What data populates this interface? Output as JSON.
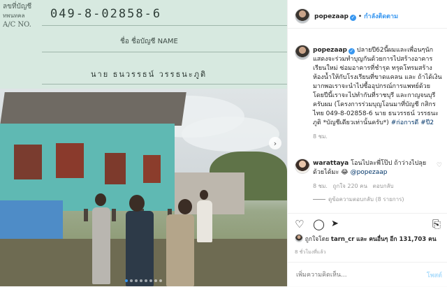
{
  "passbook": {
    "acct_label_th": "ลขที่บัญชี",
    "acct_label_th2": "บัญชี",
    "acct_label_th3": "ทพนทคล",
    "acct_label_en": "A/C NO.",
    "account_number": "049-8-02858-6",
    "name_label": "ชื่อ ชื่อบัญชี NAME",
    "owner_name": "นาย ธนวรรธน์ วรรธนะภูติ"
  },
  "carousel": {
    "next_icon": "chevron-right-icon",
    "count": 8,
    "active": 0
  },
  "header": {
    "username": "popezaap",
    "separator": "•",
    "follow_label": "กำลังติดตาม"
  },
  "caption": {
    "username": "popezaap",
    "text": "ปลายปี62นี้ผมและเพื่อนๆนักแสดงจะร่วมทำบุญกันด้วยการไปสร้างอาคารเรียนใหม่ ซ่อมอาคารที่ชำรุด ทรุดโทรมสร้างห้องน้ำให้กับโรงเรียนที่ขาดแคลน และ ถ้าได้เงินมากพอเราจะนำไปซื้ออุปกรณ์การแพทย์ด้วย โดยปีนี้เราจะไปทำกันที่ราชบุรี และกาญจนบุรี ครับผม (โครงการร่วมบุญโอนมาที่บัญชี กสิกรไทย 049-8-02858-6 นาย ธนวรรธน์ วรรธนะภูติ *บัญชีเดียวเท่านั้นครับ*)",
    "hashtag1": "#ก่อการดี",
    "hashtag2": "#ปี2",
    "time": "8 ชม."
  },
  "comment": {
    "username": "warattaya",
    "text": "โอนไปละพี่โป๊ป ถ้าว่างไปลุยด้วยได้มะ 😂",
    "mention": "@popezaap",
    "time": "8 ชม.",
    "likes": "ถูกใจ 220 คน",
    "reply": "ตอบกลับ",
    "view_replies": "ดูข้อความตอบกลับ (8 รายการ)"
  },
  "actions": {
    "like_icon": "heart-icon",
    "comment_icon": "comment-icon",
    "share_icon": "share-icon",
    "save_icon": "bookmark-icon"
  },
  "likes": {
    "prefix": "ถูกใจโดย",
    "user": "tarn_cr",
    "rest": "และ คนอื่นๆ อีก 131,703 คน"
  },
  "timestamp": "8 ชั่วโมงที่แล้ว",
  "add_comment": {
    "placeholder": "เพิ่มความคิดเห็น...",
    "post_label": "โพสต์"
  }
}
